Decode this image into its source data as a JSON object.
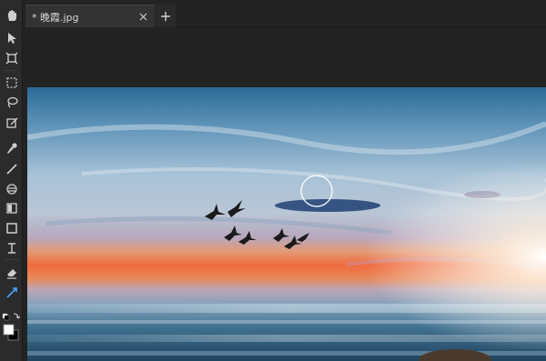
{
  "document_tab": {
    "title": "* 晚霞.jpg",
    "close_icon": "close-icon",
    "add_icon": "plus-icon"
  },
  "toolbar": {
    "tools": [
      {
        "name": "hand-tool",
        "icon": "hand-icon"
      },
      {
        "name": "select-tool",
        "icon": "pointer-icon"
      },
      {
        "name": "transform-tool",
        "icon": "transform-icon"
      },
      {
        "name": "marquee-tool",
        "icon": "marquee-icon"
      },
      {
        "name": "lasso-tool",
        "icon": "lasso-icon"
      },
      {
        "name": "quick-select-tool",
        "icon": "quick-select-icon"
      },
      {
        "name": "eyedropper-tool",
        "icon": "eyedropper-icon"
      },
      {
        "name": "brush-tool",
        "icon": "brush-icon"
      },
      {
        "name": "stamp-tool",
        "icon": "stamp-icon"
      },
      {
        "name": "gradient-tool",
        "icon": "gradient-icon"
      },
      {
        "name": "shape-tool",
        "icon": "rectangle-icon"
      },
      {
        "name": "text-tool",
        "icon": "text-icon"
      },
      {
        "name": "eraser-tool",
        "icon": "eraser-icon"
      },
      {
        "name": "healing-tool",
        "icon": "healing-icon",
        "active": true
      }
    ],
    "foreground_color": "#ffffff",
    "background_color": "#000000"
  },
  "colors": {
    "accent": "#4aa3ff",
    "panel": "#2b2b2b",
    "tab": "#333333"
  }
}
